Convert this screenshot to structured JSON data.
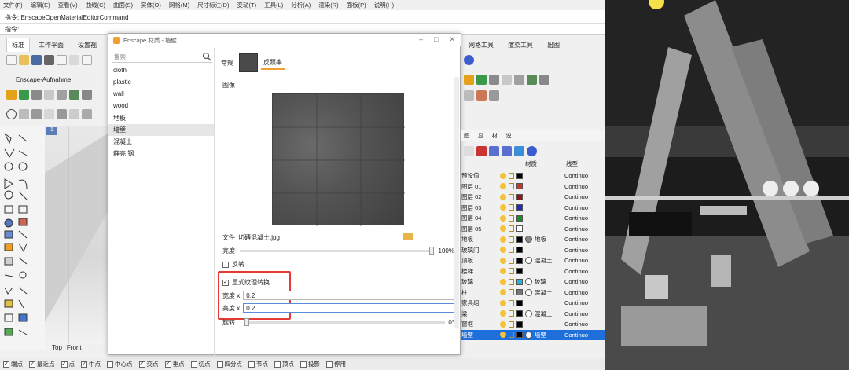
{
  "menu": [
    "文件(F)",
    "编辑(E)",
    "查看(V)",
    "曲线(C)",
    "曲面(S)",
    "实体(O)",
    "网格(M)",
    "尺寸标注(D)",
    "变动(T)",
    "工具(L)",
    "分析(A)",
    "渲染(R)",
    "面板(P)",
    "说明(H)"
  ],
  "command_history": "指令: EnscapeOpenMaterialEditorCommand",
  "command_prompt": "指令:",
  "ribbon_tabs": [
    "标准",
    "工作平面",
    "设置视"
  ],
  "ribbon_tab_active": "标准",
  "ribbon_tab_right": [
    "网格工具",
    "渲染工具",
    "出图"
  ],
  "enscape_toolbar_label": "Enscape-Aufnahme",
  "viewport_tabs": [
    "Top",
    "Front"
  ],
  "viewport_tab_index": "1",
  "snaps": [
    {
      "label": "端点",
      "checked": true
    },
    {
      "label": "最近点",
      "checked": true
    },
    {
      "label": "点",
      "checked": true
    },
    {
      "label": "中点",
      "checked": true
    },
    {
      "label": "中心点",
      "checked": false
    },
    {
      "label": "交点",
      "checked": true
    },
    {
      "label": "垂点",
      "checked": true
    },
    {
      "label": "切点",
      "checked": false
    },
    {
      "label": "四分点",
      "checked": false
    },
    {
      "label": "节点",
      "checked": false
    },
    {
      "label": "顶点",
      "checked": false
    },
    {
      "label": "投影",
      "checked": false
    },
    {
      "label": "停用",
      "checked": false
    }
  ],
  "dialog": {
    "title": "Enscape 材质 - 墙壁",
    "search_placeholder": "搜索",
    "materials": [
      "cloth",
      "plastic",
      "wall",
      "wood",
      "地板",
      "墙壁",
      "混凝土",
      "静亮 钢"
    ],
    "selected_material": "墙壁",
    "tab_general": "常规",
    "tab_albedo": "反照率",
    "section_image": "图像",
    "file_label": "文件",
    "file_name": "切磚混凝土.jpg",
    "brightness_label": "亮度",
    "brightness_value": "100%",
    "brightness_fraction": 1.0,
    "invert_label": "反转",
    "invert_checked": false,
    "explicit_label": "显式纹理转换",
    "explicit_checked": true,
    "width_label": "宽度 x",
    "width_value": "0.2",
    "height_label": "高度 x",
    "height_value": "0.2",
    "rotation_label": "旋转",
    "rotation_value": "0°"
  },
  "layers_panel": {
    "tabs": [
      "图...",
      "显...",
      "材...",
      "说..."
    ],
    "col_material": "材质",
    "col_linetype": "线型",
    "rows": [
      {
        "name": "预设值",
        "color": "#000000",
        "material": "",
        "linetype": "Continuo"
      },
      {
        "name": "图层 01",
        "color": "#c0392b",
        "material": "",
        "linetype": "Continuo"
      },
      {
        "name": "图层 02",
        "color": "#8b1a1a",
        "material": "",
        "linetype": "Continuo"
      },
      {
        "name": "图层 03",
        "color": "#1f2fb5",
        "material": "",
        "linetype": "Continuo"
      },
      {
        "name": "图层 04",
        "color": "#1e8a2c",
        "material": "",
        "linetype": "Continuo"
      },
      {
        "name": "图层 05",
        "color": "#ffffff",
        "material": "",
        "linetype": "Continuo"
      },
      {
        "name": "地板",
        "color": "#000000",
        "material": "地板",
        "linetype": "Continuo"
      },
      {
        "name": "玻璃门",
        "color": "#000000",
        "material": "",
        "linetype": "Continuo"
      },
      {
        "name": "顶板",
        "color": "#000000",
        "material": "混凝土",
        "linetype": "Continuo"
      },
      {
        "name": "楼梯",
        "color": "#000000",
        "material": "",
        "linetype": "Continuo"
      },
      {
        "name": "玻璃",
        "color": "#25b6d6",
        "material": "玻璃",
        "linetype": "Continuo"
      },
      {
        "name": "柱",
        "color": "#777777",
        "material": "混凝土",
        "linetype": "Continuo"
      },
      {
        "name": "家具组",
        "color": "#000000",
        "material": "",
        "linetype": "Continuo"
      },
      {
        "name": "梁",
        "color": "#000000",
        "material": "混凝土",
        "linetype": "Continuo"
      },
      {
        "name": "窗框",
        "color": "#000000",
        "material": "",
        "linetype": "Continuo"
      },
      {
        "name": "墙壁",
        "color": "#000000",
        "material": "墙壁",
        "linetype": "Continuo",
        "selected": true
      }
    ]
  }
}
